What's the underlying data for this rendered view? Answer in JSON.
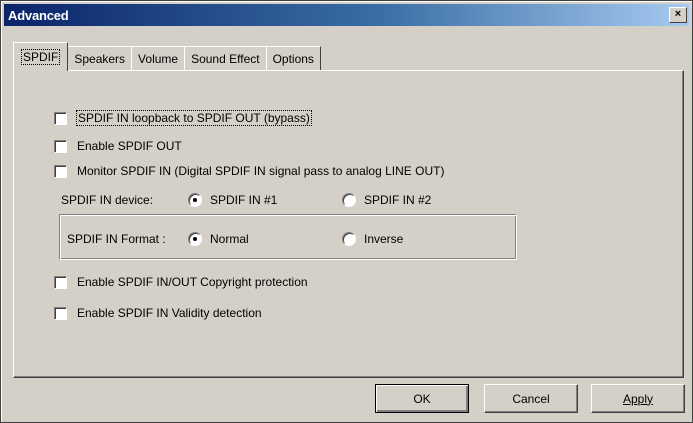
{
  "window": {
    "title": "Advanced",
    "close_glyph": "×"
  },
  "tabs": [
    {
      "label": "SPDIF",
      "active": true
    },
    {
      "label": "Speakers",
      "active": false
    },
    {
      "label": "Volume",
      "active": false
    },
    {
      "label": "Sound Effect",
      "active": false
    },
    {
      "label": "Options",
      "active": false
    }
  ],
  "spdif": {
    "loopback": {
      "label": "SPDIF IN loopback to SPDIF OUT (bypass)",
      "checked": false
    },
    "enable_out": {
      "label": "Enable SPDIF OUT",
      "checked": false
    },
    "monitor_in": {
      "label": "Monitor SPDIF IN  (Digital SPDIF IN signal pass to analog LINE OUT)",
      "checked": false
    },
    "in_device": {
      "label": "SPDIF IN device:",
      "options": [
        {
          "label": "SPDIF IN #1",
          "selected": true
        },
        {
          "label": "SPDIF IN #2",
          "selected": false
        }
      ]
    },
    "in_format": {
      "label": "SPDIF IN Format :",
      "options": [
        {
          "label": "Normal",
          "selected": true
        },
        {
          "label": "Inverse",
          "selected": false
        }
      ]
    },
    "copyright": {
      "label": "Enable SPDIF IN/OUT Copyright protection",
      "checked": false
    },
    "validity": {
      "label": "Enable SPDIF IN Validity detection",
      "checked": false
    }
  },
  "buttons": {
    "ok": "OK",
    "cancel": "Cancel",
    "apply": "Apply"
  }
}
